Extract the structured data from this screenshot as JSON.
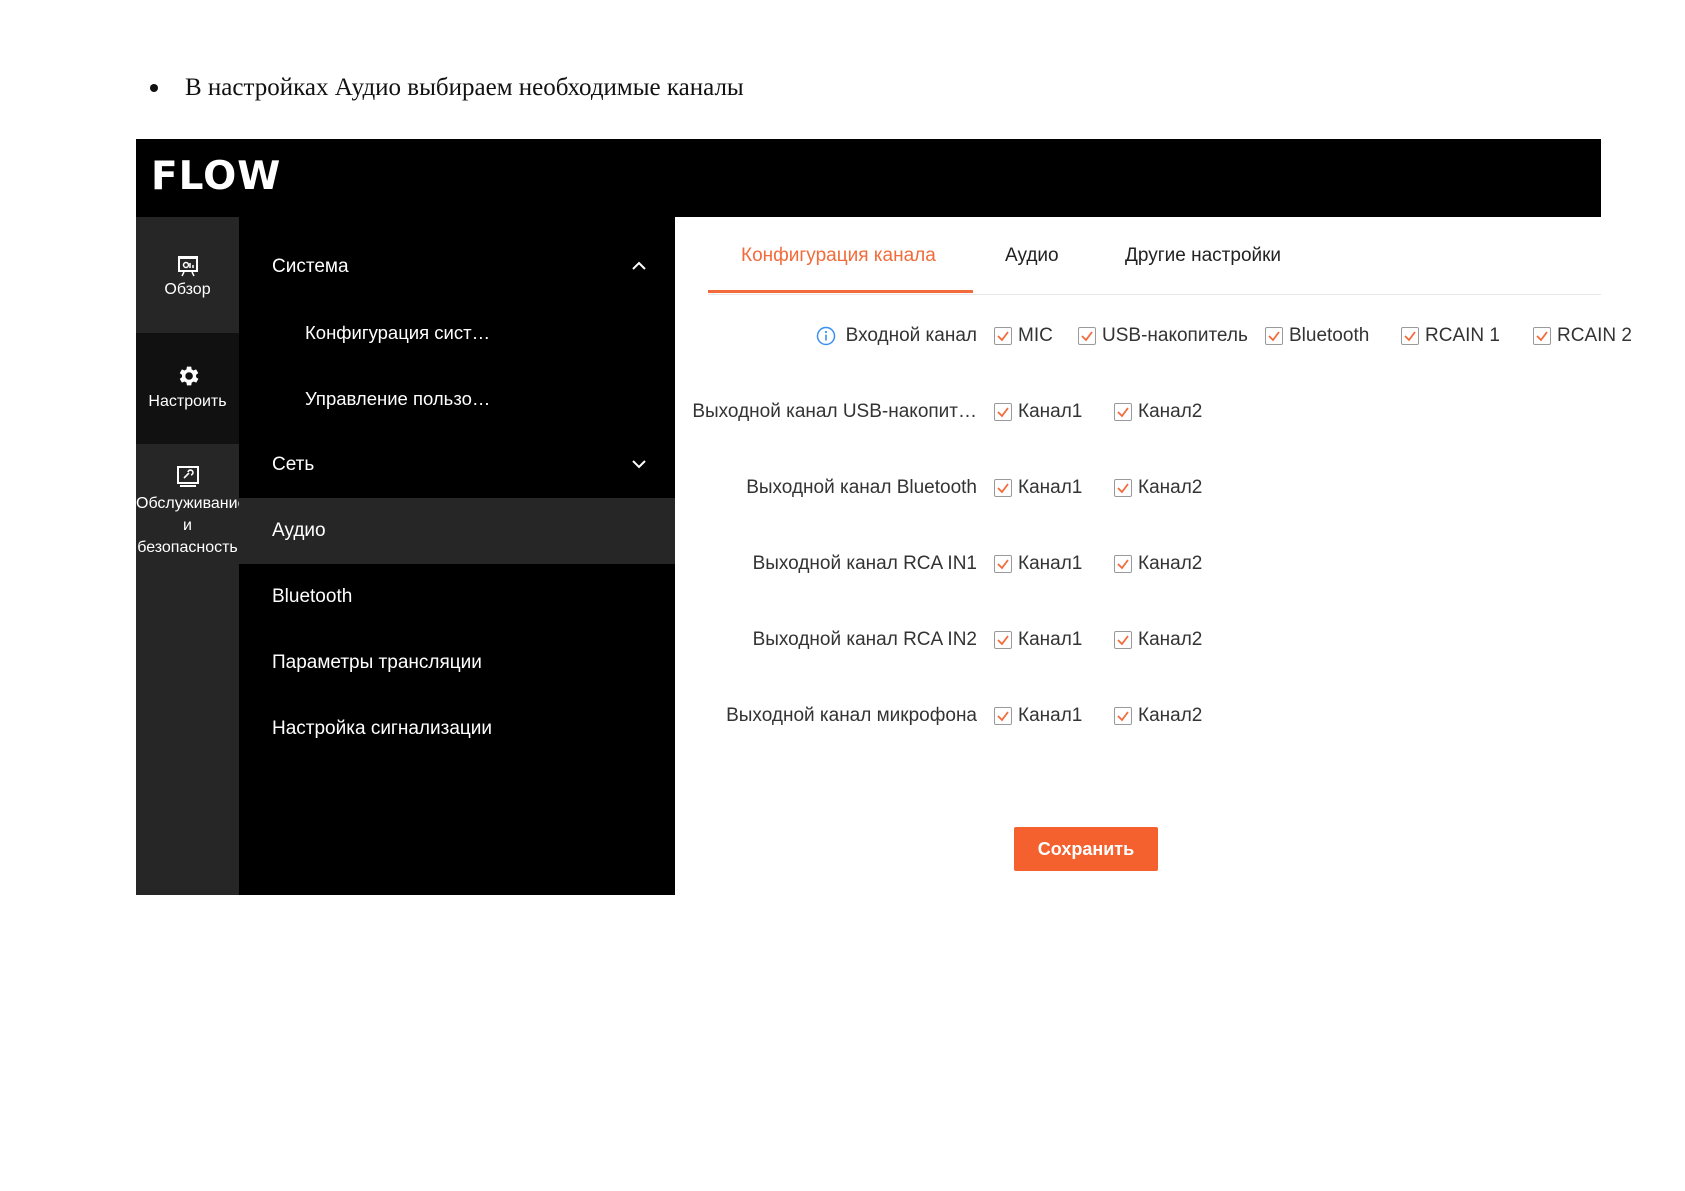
{
  "document": {
    "instruction": "В настройках Аудио выбираем необходимые каналы"
  },
  "app": {
    "logo": "FLOW"
  },
  "rail": {
    "items": [
      {
        "label": "Обзор",
        "icon": "overview-icon"
      },
      {
        "label": "Настроить",
        "icon": "gear-icon"
      },
      {
        "label": "Обслуживание и безопасность",
        "icon": "maintenance-icon"
      }
    ]
  },
  "menu": {
    "items": [
      {
        "label": "Система"
      },
      {
        "label": "Конфигурация сист…"
      },
      {
        "label": "Управление пользо…"
      },
      {
        "label": "Сеть"
      },
      {
        "label": "Аудио"
      },
      {
        "label": "Bluetooth"
      },
      {
        "label": "Параметры трансляции"
      },
      {
        "label": "Настройка сигнализации"
      }
    ]
  },
  "tabs": [
    {
      "label": "Конфигурация канала"
    },
    {
      "label": "Аудио"
    },
    {
      "label": "Другие настройки"
    }
  ],
  "form": {
    "rows": [
      {
        "label": "Входной канал",
        "options": [
          {
            "label": "MIC",
            "checked": true
          },
          {
            "label": "USB-накопитель",
            "checked": true
          },
          {
            "label": "Bluetooth",
            "checked": true
          },
          {
            "label": "RCAIN 1",
            "checked": true
          },
          {
            "label": "RCAIN 2",
            "checked": true
          }
        ]
      },
      {
        "label": "Выходной канал USB-накопит…",
        "options": [
          {
            "label": "Канал1",
            "checked": true
          },
          {
            "label": "Канал2",
            "checked": true
          }
        ]
      },
      {
        "label": "Выходной канал Bluetooth",
        "options": [
          {
            "label": "Канал1",
            "checked": true
          },
          {
            "label": "Канал2",
            "checked": true
          }
        ]
      },
      {
        "label": "Выходной канал RCA IN1",
        "options": [
          {
            "label": "Канал1",
            "checked": true
          },
          {
            "label": "Канал2",
            "checked": true
          }
        ]
      },
      {
        "label": "Выходной канал RCA IN2",
        "options": [
          {
            "label": "Канал1",
            "checked": true
          },
          {
            "label": "Канал2",
            "checked": true
          }
        ]
      },
      {
        "label": "Выходной канал микрофона",
        "options": [
          {
            "label": "Канал1",
            "checked": true
          },
          {
            "label": "Канал2",
            "checked": true
          }
        ]
      }
    ],
    "save_label": "Сохранить"
  },
  "colors": {
    "accent": "#f26b3a",
    "button": "#f4602e",
    "topbar": "#000000",
    "rail": "#262626",
    "menu": "#000000",
    "info": "#3b8ff0"
  }
}
